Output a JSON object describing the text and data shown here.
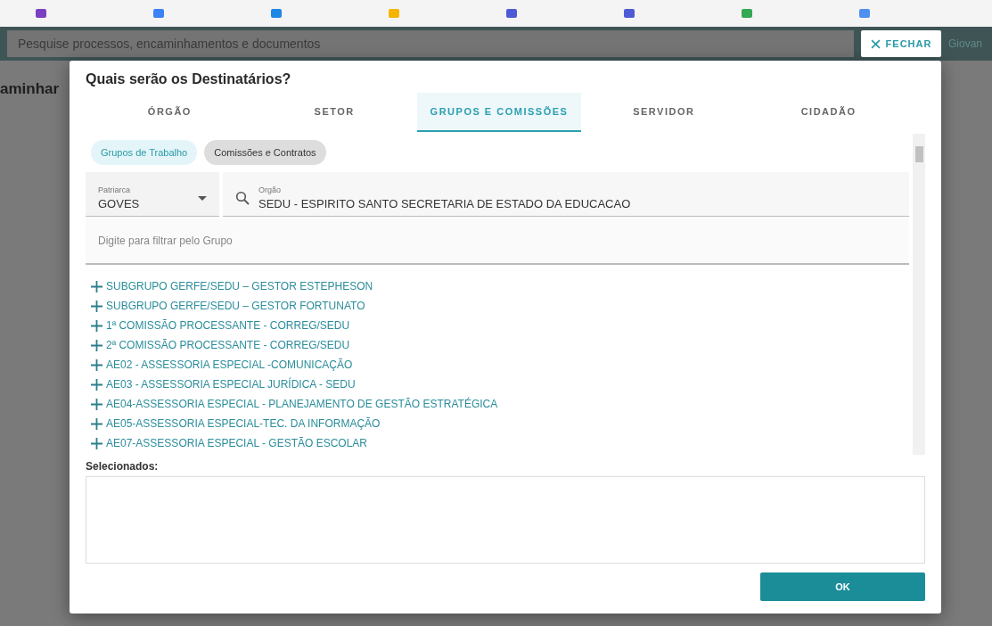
{
  "bookmarks": [
    {
      "color": "#7b3fc4"
    },
    {
      "color": "#3b82f6"
    },
    {
      "color": "#1e88e5"
    },
    {
      "color": "#f4b400"
    },
    {
      "color": "#4f5bd5"
    },
    {
      "color": "#4f5bd5"
    },
    {
      "color": "#34a853"
    },
    {
      "color": "#4f8ff0"
    }
  ],
  "header": {
    "search": {
      "placeholder": "Pesquise processos, encaminhamentos e documentos"
    },
    "close_button": "FECHAR",
    "user": "Giovan"
  },
  "page_title": "aminhar",
  "dialog": {
    "title": "Quais serão os Destinatários?",
    "tabs": [
      {
        "label": "ÓRGÃO",
        "selected": false
      },
      {
        "label": "SETOR",
        "selected": false
      },
      {
        "label": "GRUPOS E COMISSÕES",
        "selected": true
      },
      {
        "label": "SERVIDOR",
        "selected": false
      },
      {
        "label": "CIDADÃO",
        "selected": false
      }
    ],
    "chips": [
      {
        "label": "Grupos de Trabalho",
        "selected": true
      },
      {
        "label": "Comissões e Contratos",
        "selected": false
      }
    ],
    "patriarca": {
      "label": "Patriarca",
      "value": "GOVES"
    },
    "orgao": {
      "label": "Orgão",
      "value": "SEDU - ESPIRITO SANTO SECRETARIA DE ESTADO DA EDUCACAO"
    },
    "filter": {
      "placeholder": "Digite para filtrar pelo Grupo"
    },
    "groups": [
      "SUBGRUPO GERFE/SEDU – GESTOR ESTEPHESON",
      "SUBGRUPO GERFE/SEDU – GESTOR FORTUNATO",
      "1ª COMISSÃO PROCESSANTE - CORREG/SEDU",
      "2ª COMISSÃO PROCESSANTE - CORREG/SEDU",
      "AE02 - ASSESSORIA ESPECIAL -COMUNICAÇÃO",
      "AE03 - ASSESSORIA ESPECIAL JURÍDICA - SEDU",
      "AE04-ASSESSORIA ESPECIAL - PLANEJAMENTO DE GESTÃO ESTRATÉGICA",
      "AE05-ASSESSORIA ESPECIAL-TEC. DA INFORMAÇÃO",
      "AE07-ASSESSORIA ESPECIAL - GESTÃO ESCOLAR"
    ],
    "selected_label": "Selecionados:",
    "ok_button": "OK"
  }
}
